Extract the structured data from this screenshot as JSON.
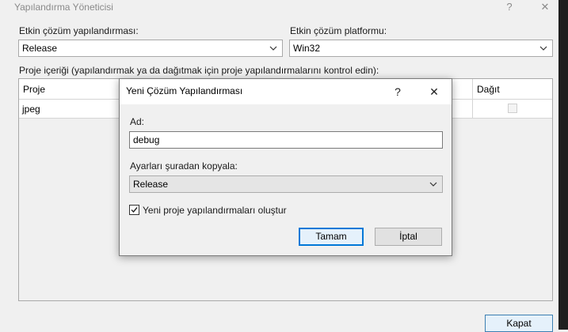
{
  "main_window": {
    "title": "Yapılandırma Yöneticisi",
    "help_glyph": "?",
    "close_glyph": "✕",
    "active_config_label": "Etkin çözüm yapılandırması:",
    "active_config_value": "Release",
    "active_platform_label": "Etkin çözüm platformu:",
    "active_platform_value": "Win32",
    "project_contexts_label": "Proje içeriği (yapılandırmak ya da dağıtmak için proje yapılandırmalarını kontrol edin):",
    "grid": {
      "columns": [
        "Proje",
        "Dağıt"
      ],
      "rows": [
        {
          "project": "jpeg",
          "deploy_checked": false
        }
      ]
    },
    "close_button": "Kapat"
  },
  "modal": {
    "title": "Yeni Çözüm Yapılandırması",
    "help_glyph": "?",
    "close_glyph": "✕",
    "name_label": "Ad:",
    "name_value": "debug",
    "copy_from_label": "Ayarları şuradan kopyala:",
    "copy_from_value": "Release",
    "create_projects_label": "Yeni proje yapılandırmaları oluştur",
    "create_projects_checked": true,
    "ok_button": "Tamam",
    "cancel_button": "İptal"
  },
  "colors": {
    "window_bg": "#f0f0f0",
    "accent": "#0078d7"
  }
}
